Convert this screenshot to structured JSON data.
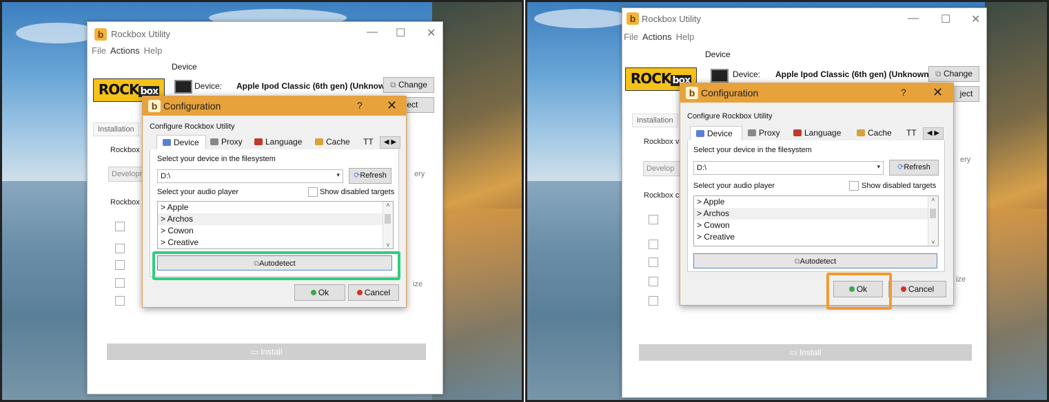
{
  "window": {
    "title": "Rockbox Utility",
    "menu": [
      "File",
      "Actions",
      "Help"
    ],
    "minimize_glyph": "—",
    "maximize_glyph": "☐",
    "close_glyph": "✕"
  },
  "device_group": {
    "title": "Device",
    "device_label": "Device:",
    "device_name": "Apple Ipod Classic (6th gen) (Unknown)",
    "change_button": "Change",
    "eject_button_partial": "Eject",
    "eject_right_partial": "ject"
  },
  "logo": {
    "rock": "ROCK",
    "box": "box"
  },
  "main_tabs": {
    "installation": "Installation"
  },
  "ghost": {
    "rockbox_version": "Rockbox v",
    "development": "Developm",
    "development_right": "Develop",
    "rockbox_components": "Rockbox c",
    "ery": "ery",
    "ize": "ize"
  },
  "install_button": "Install",
  "dialog": {
    "title": "Configuration",
    "help_glyph": "?",
    "close_glyph": "✕",
    "subtitle": "Configure Rockbox Utility",
    "tabs": [
      "Device",
      "Proxy",
      "Language",
      "Cache",
      "TT"
    ],
    "tab_scroll": "◀ ▶",
    "select_device_label": "Select your device in the filesystem",
    "device_path": "D:\\",
    "refresh_button": "Refresh",
    "select_player_label": "Select your audio player",
    "show_disabled_label": "Show disabled targets",
    "players": [
      "> Apple",
      "> Archos",
      "> Cowon",
      "> Creative"
    ],
    "autodetect_button": "Autodetect",
    "ok_button": "Ok",
    "cancel_button": "Cancel"
  },
  "colors": {
    "dialog_title_bg": "#e8a23c",
    "highlight_left": "#2ecf7b",
    "highlight_right": "#f39a2e",
    "ok_icon": "#3aa84a",
    "cancel_icon": "#d0342c"
  }
}
